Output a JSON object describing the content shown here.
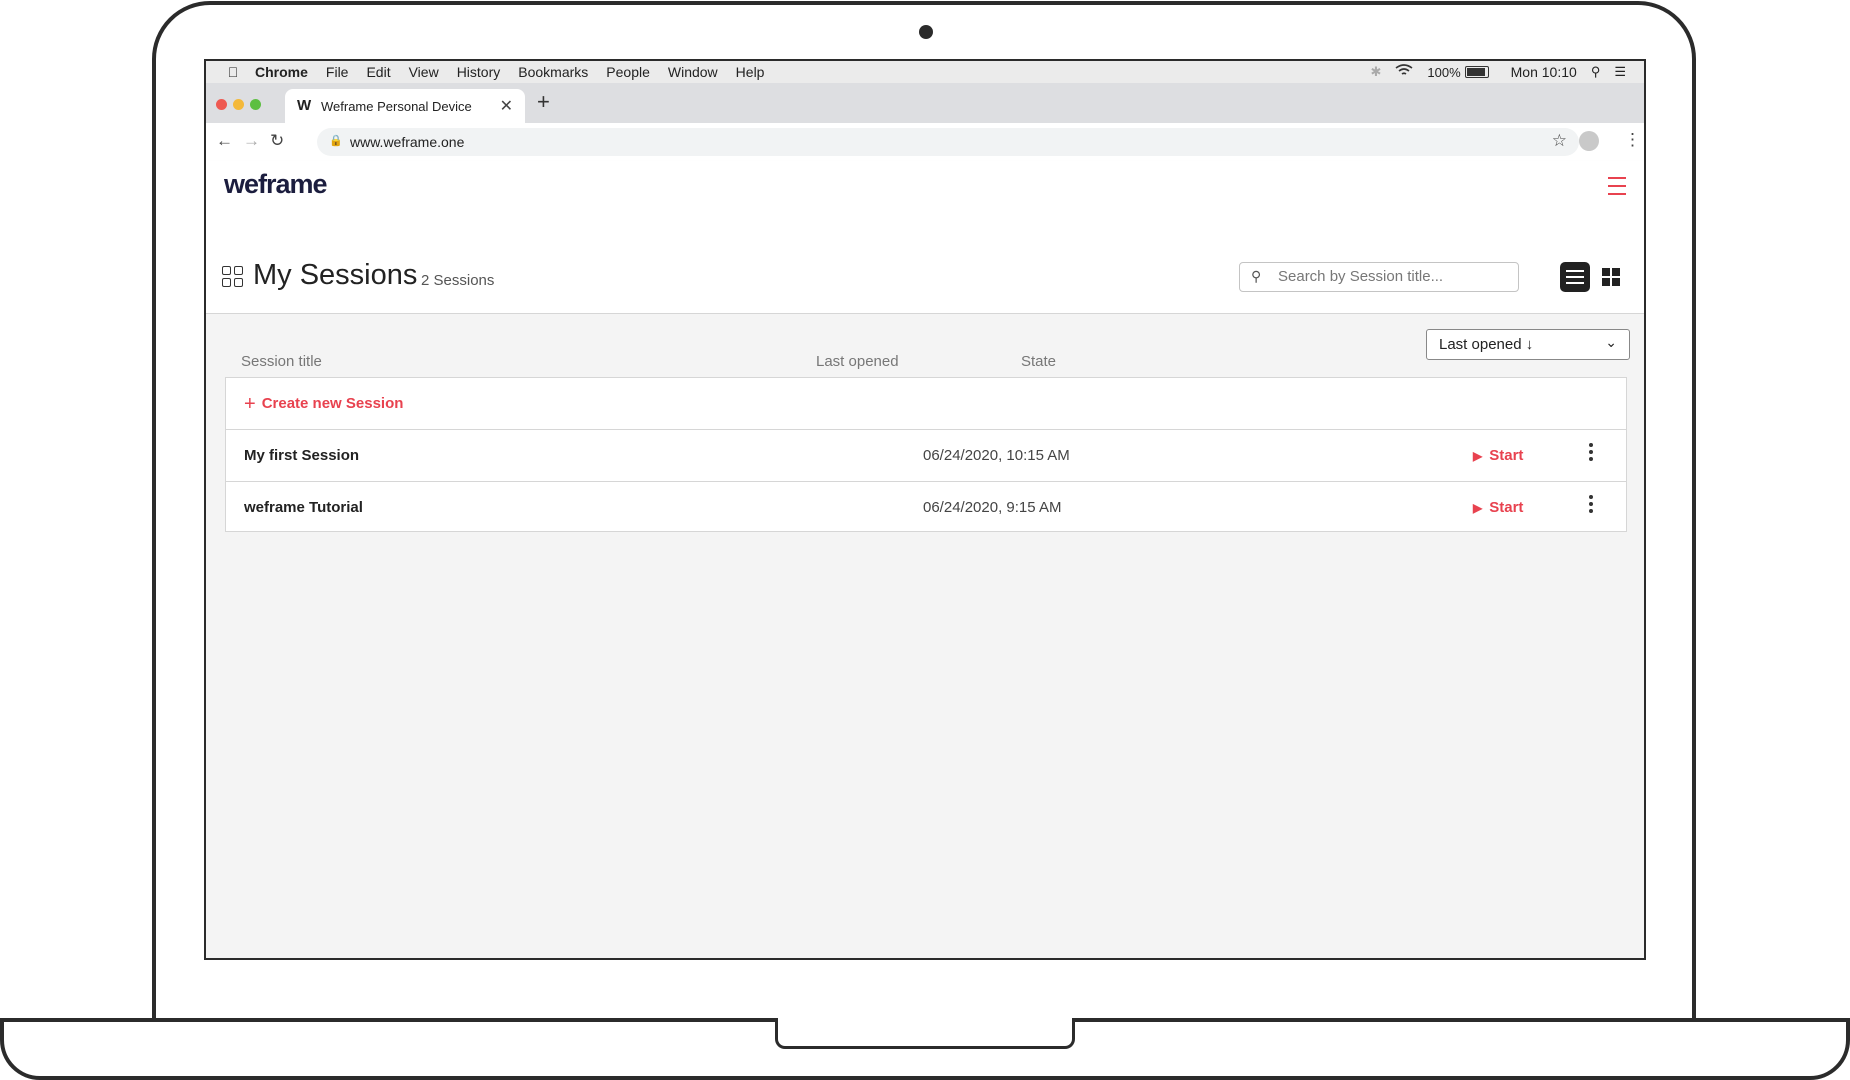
{
  "menubar": {
    "app_name": "Chrome",
    "items": [
      "File",
      "Edit",
      "View",
      "History",
      "Bookmarks",
      "People",
      "Window",
      "Help"
    ],
    "battery": "100%",
    "clock": "Mon 10:10"
  },
  "browser": {
    "tab_title": "Weframe Personal Device",
    "tab_favicon": "W",
    "url": "www.weframe.one"
  },
  "app": {
    "logo": "weframe",
    "page_title": "My Sessions",
    "session_count": "2 Sessions",
    "search_placeholder": "Search by Session title...",
    "sort_label": "Last opened ↓",
    "columns": [
      "Session title",
      "Last opened",
      "State"
    ],
    "create_label": "Create new Session",
    "sessions": [
      {
        "title": "My first Session",
        "last_opened": "06/24/2020, 10:15 AM",
        "action": "Start"
      },
      {
        "title": "weframe Tutorial",
        "last_opened": "06/24/2020, 9:15 AM",
        "action": "Start"
      }
    ],
    "accent_color": "#e8424f"
  }
}
